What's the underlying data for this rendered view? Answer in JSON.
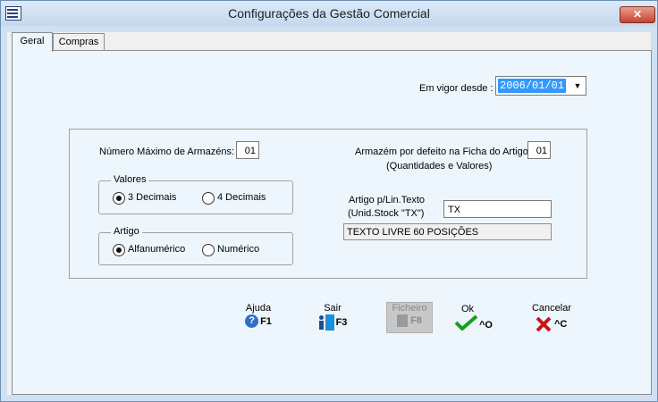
{
  "window": {
    "title": "Configurações da Gestão Comercial",
    "close_symbol": "✕"
  },
  "tabs": [
    {
      "label": "Geral"
    },
    {
      "label": "Compras"
    }
  ],
  "vigor": {
    "label": "Em vigor desde :",
    "value": "2006/01/01",
    "arrow": "▼"
  },
  "armazens": {
    "max_label": "Número Máximo de Armazéns:",
    "max_value": "01",
    "default_label": "Armazém por defeito na Ficha do Artigo:",
    "default_sub": "(Quantidades e Valores)",
    "default_value": "01"
  },
  "valores": {
    "legend": "Valores",
    "opt1": "3 Decimais",
    "opt2": "4 Decimais",
    "selected": "3 Decimais"
  },
  "artigo": {
    "legend": "Artigo",
    "opt1": "Alfanumérico",
    "opt2": "Numérico",
    "selected": "Alfanumérico"
  },
  "artigo_texto": {
    "label1": "Artigo p/Lin.Texto",
    "label2": "(Unid.Stock \"TX\")",
    "value": "TX",
    "description": "TEXTO LIVRE 60 POSIÇÕES"
  },
  "commands": {
    "ajuda": {
      "label": "Ajuda",
      "key": "F1",
      "icon": "help-icon"
    },
    "sair": {
      "label": "Sair",
      "key": "F3",
      "icon": "exit-icon"
    },
    "ficheiro": {
      "label": "Ficheiro",
      "key": "F8",
      "icon": "file-icon"
    },
    "ok": {
      "label": "Ok",
      "key": "^O",
      "icon": "check-icon"
    },
    "cancelar": {
      "label": "Cancelar",
      "key": "^C",
      "icon": "cancel-icon"
    }
  },
  "colors": {
    "title_bg": "#cfe0f1",
    "panel_bg": "#eef6fd",
    "selection": "#3399ff",
    "ok_green": "#14a11b",
    "cancel_red": "#d11212",
    "help_blue": "#2f6fc6"
  }
}
